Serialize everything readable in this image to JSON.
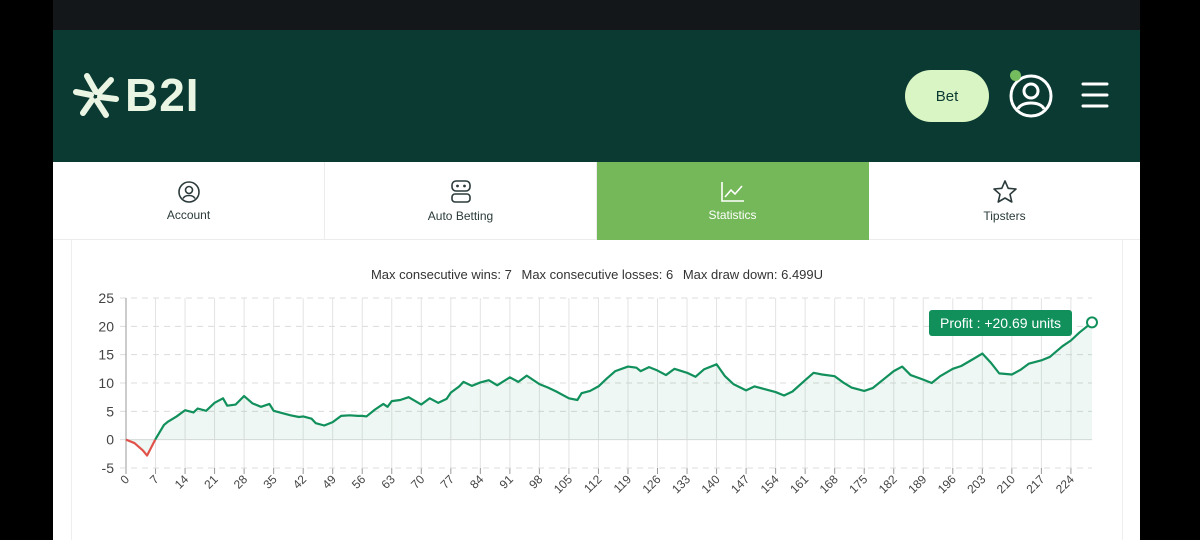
{
  "brand": {
    "logo_text": "B2I"
  },
  "header": {
    "bet_label": "Bet"
  },
  "tabs": [
    {
      "label": "Account",
      "icon": "user-circle-icon"
    },
    {
      "label": "Auto Betting",
      "icon": "robot-icon"
    },
    {
      "label": "Statistics",
      "icon": "line-chart-icon"
    },
    {
      "label": "Tipsters",
      "icon": "star-icon"
    }
  ],
  "active_tab": "Statistics",
  "colors": {
    "header": "#0b3a33",
    "accent": "#74b85a",
    "bet_button": "#d9f5c3",
    "profit_line": "#11905c",
    "loss_line": "#e0534a"
  },
  "summary": {
    "max_wins": "Max consecutive wins: 7",
    "max_losses": "Max consecutive losses: 6",
    "max_drawdown": "Max draw down: 6.499U"
  },
  "tooltip": {
    "label": "Profit : +20.69 units"
  },
  "chart_data": {
    "type": "line",
    "ylim": [
      -5,
      25
    ],
    "yticks": [
      "25",
      "20",
      "15",
      "10",
      "5",
      "0",
      "-5"
    ],
    "xticks": [
      "0",
      "7",
      "14",
      "21",
      "28",
      "35",
      "42",
      "49",
      "56",
      "63",
      "70",
      "77",
      "84",
      "91",
      "98",
      "105",
      "112",
      "119",
      "126",
      "133",
      "140",
      "147",
      "154",
      "161",
      "168",
      "175",
      "182",
      "189",
      "196",
      "203",
      "210",
      "217",
      "224"
    ],
    "grid": true,
    "x": [
      0,
      2,
      4,
      5,
      7,
      9,
      10,
      12,
      14,
      16,
      17,
      19,
      21,
      23,
      24,
      26,
      28,
      30,
      32,
      34,
      35,
      37,
      39,
      41,
      42,
      44,
      45,
      47,
      49,
      51,
      53,
      55,
      56,
      57,
      59,
      61,
      62,
      63,
      65,
      67,
      70,
      72,
      74,
      76,
      77,
      79,
      80,
      82,
      84,
      86,
      88,
      91,
      93,
      95,
      98,
      100,
      102,
      105,
      107,
      108,
      110,
      112,
      114,
      116,
      119,
      121,
      122,
      124,
      126,
      128,
      130,
      133,
      135,
      137,
      140,
      142,
      144,
      147,
      149,
      151,
      154,
      156,
      158,
      161,
      163,
      165,
      168,
      170,
      172,
      175,
      177,
      179,
      182,
      184,
      186,
      189,
      191,
      193,
      196,
      198,
      201,
      203,
      205,
      207,
      210,
      212,
      214,
      217,
      219,
      222,
      224,
      226,
      229
    ],
    "y": [
      0,
      -0.6,
      -1.9,
      -2.8,
      0.1,
      2.6,
      3.2,
      4.1,
      5.2,
      4.8,
      5.5,
      5.1,
      6.5,
      7.3,
      6.0,
      6.2,
      7.7,
      6.4,
      5.8,
      6.3,
      5.1,
      4.7,
      4.3,
      4.0,
      4.1,
      3.7,
      2.9,
      2.5,
      3.1,
      4.2,
      4.3,
      4.2,
      4.2,
      4.1,
      5.3,
      6.3,
      5.8,
      6.8,
      7.0,
      7.5,
      6.2,
      7.3,
      6.5,
      7.2,
      8.3,
      9.4,
      10.2,
      9.5,
      10.1,
      10.5,
      9.6,
      11.0,
      10.2,
      11.3,
      9.8,
      9.2,
      8.5,
      7.3,
      7.0,
      8.2,
      8.6,
      9.4,
      10.8,
      12.1,
      12.9,
      12.7,
      12.1,
      12.8,
      12.2,
      11.4,
      12.5,
      11.8,
      11.1,
      12.4,
      13.3,
      11.2,
      9.8,
      8.7,
      9.4,
      9.0,
      8.4,
      7.8,
      8.5,
      10.5,
      11.8,
      11.5,
      11.2,
      10.1,
      9.2,
      8.6,
      9.1,
      10.3,
      12.1,
      12.9,
      11.4,
      10.6,
      10.0,
      11.2,
      12.5,
      13.0,
      14.3,
      15.2,
      13.6,
      11.7,
      11.5,
      12.3,
      13.4,
      14.0,
      14.6,
      16.5,
      17.5,
      18.9,
      20.69
    ]
  }
}
